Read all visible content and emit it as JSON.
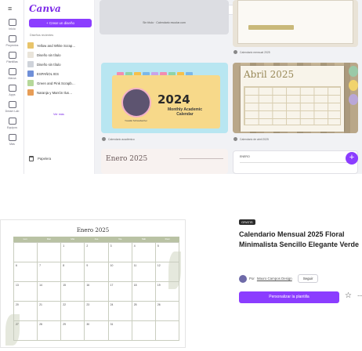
{
  "app": {
    "logo": "Canva",
    "rail": [
      {
        "icon": "home-icon",
        "label": "Inicio"
      },
      {
        "icon": "folder-icon",
        "label": "Proyectos"
      },
      {
        "icon": "templates-icon",
        "label": "Plantillas"
      },
      {
        "icon": "brand-icon",
        "label": "Marca"
      },
      {
        "icon": "apps-icon",
        "label": "Apps"
      },
      {
        "icon": "dream-lab-icon",
        "label": "Dream Lab"
      },
      {
        "icon": "teams-icon",
        "label": "Equipos"
      },
      {
        "icon": "more-icon",
        "label": "Más"
      }
    ],
    "create_button": "+  Crear un diseño",
    "recent_heading": "Diseños recientes",
    "recent": [
      {
        "label": "Yellow and White Scrap…",
        "color": "#e8c46a"
      },
      {
        "label": "Diseño sin título",
        "color": "#e9e4da"
      },
      {
        "label": "Diseño sin título",
        "color": "#cfd3da"
      },
      {
        "label": "ESPAÑOL IES",
        "color": "#6f8fd8"
      },
      {
        "label": "Green and Pink Scrapb…",
        "color": "#b6d89a"
      },
      {
        "label": "Naranja y Marrón Ilus…",
        "color": "#e79d57"
      }
    ],
    "see_more": "Ver más",
    "trash": "Papelera",
    "search_placeholder": "Calendario académico",
    "user": {
      "name": "Milamores",
      "sub": "Milamores, Milamor…"
    }
  },
  "cards": {
    "c1_caption": "Sin título · Calendario escolar.com",
    "c2_meta": "Calendario mensual 2025",
    "c3": {
      "year": "2024",
      "subtitle": "Monthly Academic Calendar",
      "small": "Yosafat Schwabacher",
      "meta": "Calendario académico"
    },
    "c4": {
      "title": "Abril 2025",
      "meta": "Calendario de abril 2025"
    },
    "c5_title": "Enero 2025",
    "c6_title": "ENERO"
  },
  "template": {
    "calendar_title": "Enero 2025",
    "weekdays": [
      "Lun",
      "Mar",
      "Mié",
      "Jue",
      "Vie",
      "Sáb",
      "Dom"
    ],
    "days": [
      "",
      "",
      "1",
      "2",
      "3",
      "4",
      "5",
      "6",
      "7",
      "8",
      "9",
      "10",
      "11",
      "12",
      "13",
      "14",
      "15",
      "16",
      "17",
      "18",
      "19",
      "20",
      "21",
      "22",
      "23",
      "24",
      "25",
      "26",
      "27",
      "28",
      "29",
      "30",
      "31",
      "",
      ""
    ],
    "badge": "GRATIS",
    "title": "Calendario Mensual 2025 Floral Minimalista Sencillo Elegante Verde",
    "author_prefix": "Por",
    "author_name": "Mauro Campos Design",
    "follow": "Seguir",
    "cta": "Personalizar la plantilla"
  },
  "colors": {
    "accent": "#8b3dff",
    "calendar_header": "#b9c2a4"
  }
}
